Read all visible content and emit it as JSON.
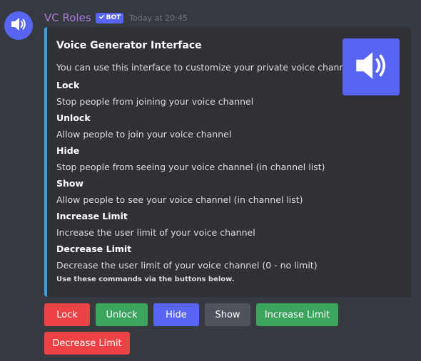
{
  "message": {
    "username": "VC Roles",
    "bot_tag": "BOT",
    "timestamp": "Today at 20:45",
    "avatar_icon": "speaker-icon"
  },
  "embed": {
    "accent_color": "#3aa0e0",
    "title": "Voice Generator Interface",
    "description": "You can use this interface to customize your private voice channel.",
    "thumbnail_icon": "speaker-icon",
    "fields": [
      {
        "name": "Lock",
        "value": "Stop people from joining your voice channel"
      },
      {
        "name": "Unlock",
        "value": "Allow people to join your voice channel"
      },
      {
        "name": "Hide",
        "value": "Stop people from seeing your voice channel (in channel list)"
      },
      {
        "name": "Show",
        "value": "Allow people to see your voice channel (in channel list)"
      },
      {
        "name": "Increase Limit",
        "value": "Increase the user limit of your voice channel"
      },
      {
        "name": "Decrease Limit",
        "value": "Decrease the user limit of your voice channel (0 - no limit)"
      }
    ],
    "footer": "Use these commands via the buttons below."
  },
  "buttons": [
    {
      "label": "Lock",
      "style": "danger"
    },
    {
      "label": "Unlock",
      "style": "success"
    },
    {
      "label": "Hide",
      "style": "primary"
    },
    {
      "label": "Show",
      "style": "secondary"
    },
    {
      "label": "Increase Limit",
      "style": "success"
    },
    {
      "label": "Decrease Limit",
      "style": "danger"
    }
  ]
}
